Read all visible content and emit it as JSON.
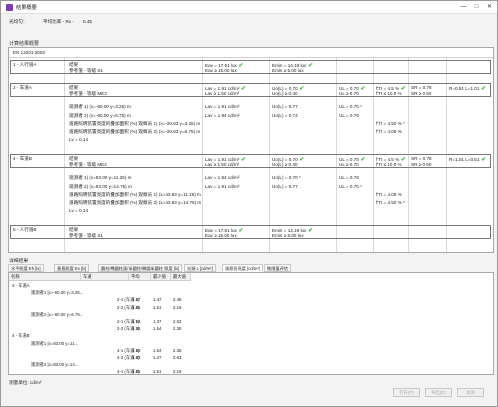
{
  "window": {
    "title": "结果概要",
    "controls": [
      "—",
      "□",
      "✕"
    ]
  },
  "subbar": {
    "label_left": "光均匀：",
    "label_mid": "平均比率 - Rx -",
    "ratio": "0.45"
  },
  "section_title": "计算结果概要",
  "standard": "EN 13201:2003",
  "groups": [
    {
      "name": "1 - 人行道A",
      "rows": [
        {
          "label": "结果",
          "c1": "Eav = 17.61 lux",
          "c1_ok": true,
          "c2": "Emin = 14.19 lux",
          "c2_ok": true
        },
        {
          "label": "参考值 - 等级 S1",
          "c1": "Eav ≥  15.00 lux",
          "c2": "Emin ≥  5.00 lux"
        }
      ]
    },
    {
      "name": "2 - 车道A",
      "rows": [
        {
          "label": "结果",
          "c1": "Lav = 1.91 cd/m²",
          "c1_ok": true,
          "c2": "Uo(L) = 0.70",
          "c2_ok": true,
          "c3": "UL = 0.70",
          "c3_ok": true,
          "c4": "f'TI = 4.5 %",
          "c4_ok": true,
          "c5": "SR = 0.78",
          "c6": "R=0.51 L=1.01",
          "c6_ok": true
        },
        {
          "label": "参考值 - 等级 ME2",
          "c1": "Lav ≥  1.50 cd/m²",
          "c2": "Uo(L) ≥  0.40",
          "c3": "UL ≥  0.70",
          "c4": "f'TI ≤  10.0 %",
          "c5": "SR ≥  0.50"
        }
      ],
      "details": [
        {
          "label": "观测者 1) (x=-60.00 y=3.25) m",
          "c1": "Lav = 1.91 cd/m²",
          "c2": "Uo(L) = 0.77",
          "c3": "UL = 0.70 *"
        },
        {
          "label": "观测者 2) (x=-60.00 y=6.75) m",
          "c1": "Lav = 1.94 cd/m²",
          "c2": "Uo(L) = 0.74",
          "c3": "UL = 0.76"
        },
        {
          "label": "道路照明装置亮度的叠加面积 (%) 观察员 1) (x=-20.63 y=3.25) m",
          "c4": "f'TI = 4.50 % *"
        },
        {
          "label": "道路照明装置亮度的叠加面积 (%) 观察员 2) (x=-20.63 y=6.75) m",
          "c4": "f'TI = 4.06 %"
        },
        {
          "label": "Lv = 0.14"
        }
      ]
    },
    {
      "name": "4 - 车道B",
      "rows": [
        {
          "label": "结果",
          "c1": "Lav = 1.91 cd/m²",
          "c1_ok": true,
          "c2": "Uo(L) = 0.70",
          "c2_ok": true,
          "c3": "UL = 0.70",
          "c3_ok": true,
          "c4": "f'TI = 4.5 %",
          "c4_ok": true,
          "c5": "SR = 0.78",
          "c6": "R=1.01 L=0.51",
          "c6_ok": true
        },
        {
          "label": "参考值 - 等级 ME2",
          "c1": "Lav ≥  1.50 cd/m²",
          "c2": "Uo(L) ≥  0.40",
          "c3": "UL ≥  0.70",
          "c4": "f'TI ≤  10.0 %",
          "c5": "SR ≥  0.50"
        }
      ],
      "details": [
        {
          "label": "观测者 1) (x=83.00 y=11.25) m",
          "c1": "Lav = 1.94 cd/m²",
          "c2": "Uo(L) = 0.70 *",
          "c3": "UL = 0.76"
        },
        {
          "label": "观测者 2) (x=83.00 y=14.75) m",
          "c1": "Lav = 1.91 cd/m²",
          "c2": "Uo(L) = 0.77",
          "c3": "UL = 0.70 *"
        },
        {
          "label": "道路照明装置亮度的叠加面积 (%) 观察员 1) (x=43.63 y=11.25) m",
          "c4": "f'TI = 4.06 %"
        },
        {
          "label": "道路照明装置亮度的叠加面积 (%) 观察员 2) (x=43.63 y=14.75) m",
          "c4": "f'TI = 4.50 % *"
        },
        {
          "label": "Lv = 0.14"
        }
      ]
    },
    {
      "name": "5 - 人行道B",
      "rows": [
        {
          "label": "结果",
          "c1": "Eav = 17.61 lux",
          "c1_ok": true,
          "c2": "Emin = 14.19 lux",
          "c2_ok": true
        },
        {
          "label": "参考值 - 等级 S1",
          "c1": "Eav ≥  15.00 lux",
          "c2": "Emin ≥  5.00 lux"
        }
      ]
    }
  ],
  "bottom_title": "详细结果",
  "tabs": [
    "水平照度 Eh [lx]",
    "垂直照度 Ev [lx]",
    "圆柱/椭圆柱面/半圆柱/椭圆半圆柱 照度 [lx]",
    "光源 L [cd/m²]",
    "观察员亮度 [cd/m²]",
    "眩限值评估"
  ],
  "active_tab": 4,
  "grid": {
    "headers": [
      "名称",
      "车道",
      "平均",
      "最少值",
      "最大值"
    ],
    "rows": [
      {
        "name": "2 - 车道A",
        "lane": "",
        "avg": "",
        "min": "",
        "max": ""
      },
      {
        "name": "",
        "sub": "观测者1 [x=-60.00 y=3.25...",
        "lane": "",
        "avg": "",
        "min": "",
        "max": ""
      },
      {
        "name": "",
        "lane": "2-1 (车道 1)",
        "avg": "1.97",
        "min": "1.47",
        "max": "2.48"
      },
      {
        "name": "",
        "lane": "2-2 (车道 2)",
        "avg": "1.85",
        "min": "1.51",
        "max": "2.19"
      },
      {
        "name": "",
        "sub": "观测者2 [x=-60.00 y=6.75...",
        "lane": "",
        "avg": "",
        "min": "",
        "max": ""
      },
      {
        "name": "",
        "lane": "2-1 (车道 1)",
        "avg": "1.93",
        "min": "1.37",
        "max": "2.63"
      },
      {
        "name": "",
        "lane": "2-2 (车道 2)",
        "avg": "1.95",
        "min": "1.54",
        "max": "2.38"
      },
      {
        "name": "4 - 车道B",
        "lane": "",
        "avg": "",
        "min": "",
        "max": ""
      },
      {
        "name": "",
        "sub": "观测者1 [x=83.00 y=11...",
        "lane": "",
        "avg": "",
        "min": "",
        "max": ""
      },
      {
        "name": "",
        "lane": "4-1 (车道 1)",
        "avg": "1.95",
        "min": "1.54",
        "max": "2.38"
      },
      {
        "name": "",
        "lane": "4-2 (车道 2)",
        "avg": "1.93",
        "min": "1.37",
        "max": "2.63"
      },
      {
        "name": "",
        "sub": "观测者2 [x=83.00 y=14...",
        "lane": "",
        "avg": "",
        "min": "",
        "max": ""
      },
      {
        "name": "",
        "lane": "4-1 (车道 1)",
        "avg": "1.85",
        "min": "1.51",
        "max": "2.19"
      }
    ]
  },
  "units_label": "测量单位: cd/m²",
  "buttons": [
    "打开(P)",
    "导出(E)",
    "关闭"
  ]
}
